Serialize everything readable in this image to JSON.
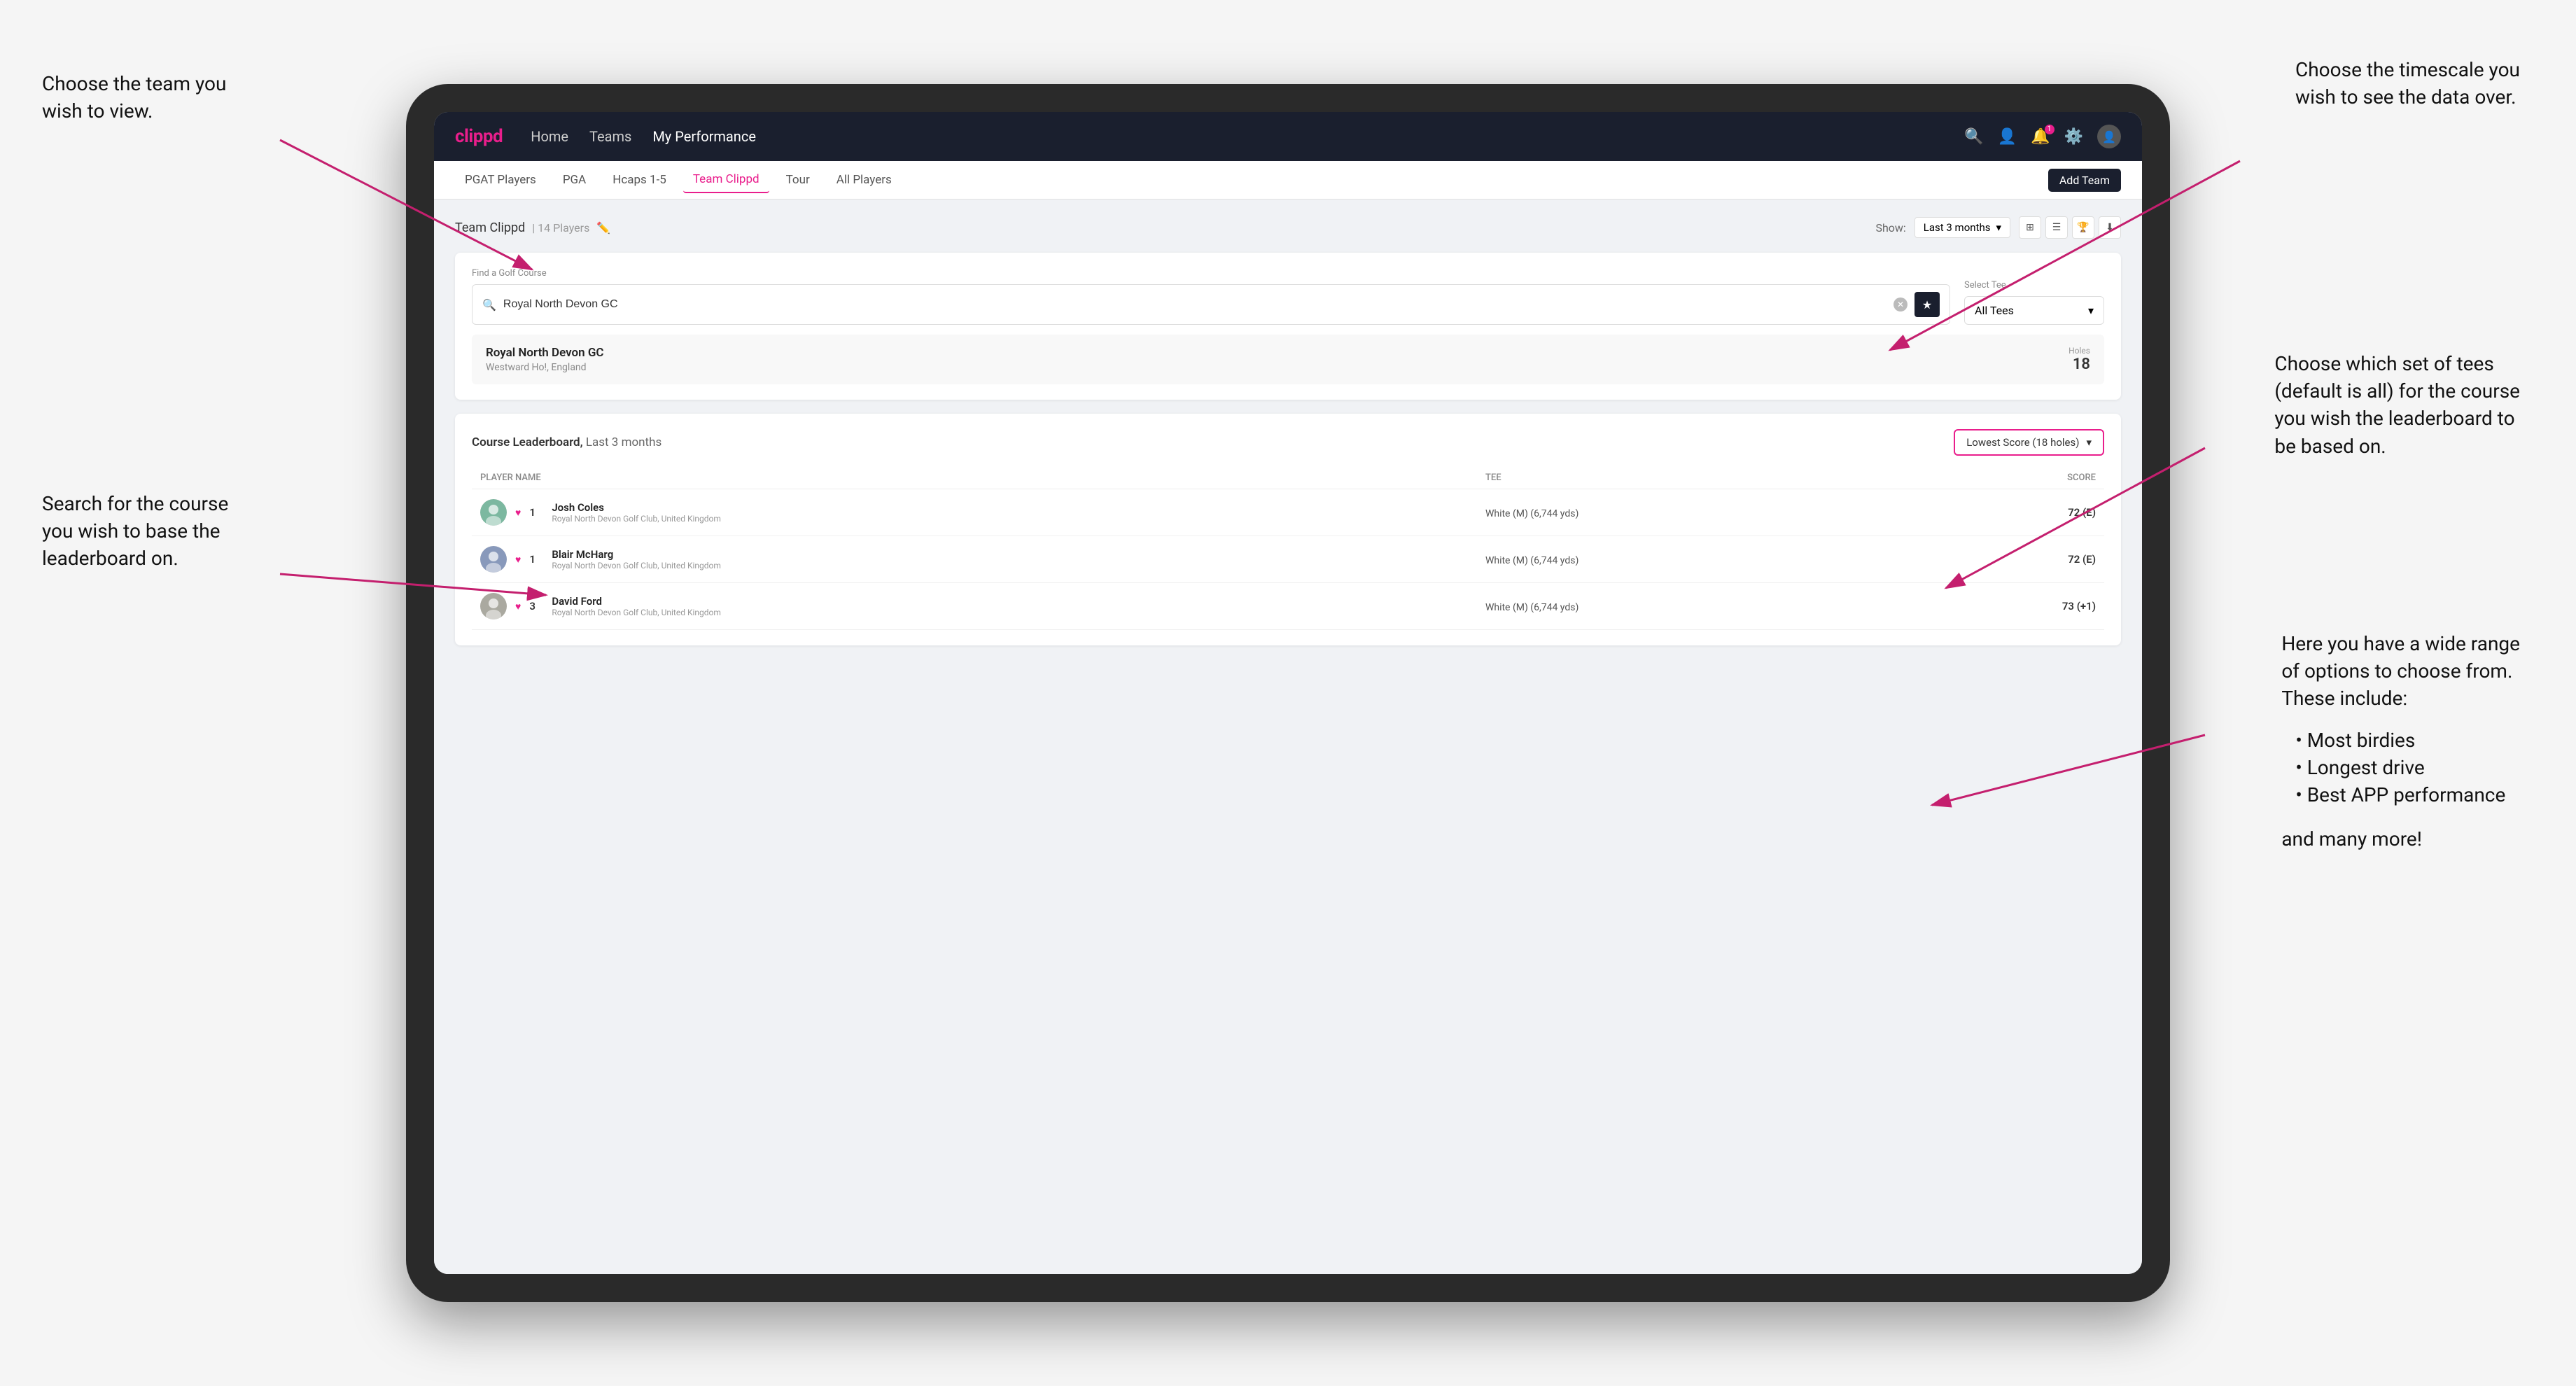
{
  "annotations": {
    "top_left_title": "Choose the team you\nwish to view.",
    "middle_left_title": "Search for the course\nyou wish to base the\nleaderboard on.",
    "top_right_title": "Choose the timescale you\nwish to see the data over.",
    "middle_right_title": "Choose which set of tees\n(default is all) for the course\nyou wish the leaderboard to\nbe based on.",
    "bottom_right_title": "Here you have a wide range\nof options to choose from.\nThese include:",
    "bullet1": "Most birdies",
    "bullet2": "Longest drive",
    "bullet3": "Best APP performance",
    "and_more": "and many more!"
  },
  "nav": {
    "logo": "clippd",
    "links": [
      "Home",
      "Teams",
      "My Performance"
    ],
    "active_link": "My Performance"
  },
  "sub_nav": {
    "links": [
      "PGAT Players",
      "PGA",
      "Hcaps 1-5",
      "Team Clippd",
      "Tour",
      "All Players"
    ],
    "active": "Team Clippd",
    "add_team_label": "Add Team"
  },
  "team_header": {
    "title": "Team Clippd",
    "player_count": "14 Players",
    "show_label": "Show:",
    "timescale": "Last 3 months"
  },
  "course_search": {
    "find_label": "Find a Golf Course",
    "search_value": "Royal North Devon GC",
    "select_tee_label": "Select Tee",
    "tee_value": "All Tees"
  },
  "course_result": {
    "name": "Royal North Devon GC",
    "location": "Westward Ho!, England",
    "holes_label": "Holes",
    "holes_value": "18"
  },
  "leaderboard": {
    "title": "Course Leaderboard,",
    "subtitle": "Last 3 months",
    "score_option": "Lowest Score (18 holes)",
    "col_player": "PLAYER NAME",
    "col_tee": "TEE",
    "col_score": "SCORE",
    "players": [
      {
        "rank": "1",
        "name": "Josh Coles",
        "club": "Royal North Devon Golf Club, United Kingdom",
        "tee": "White (M) (6,744 yds)",
        "score": "72 (E)"
      },
      {
        "rank": "1",
        "name": "Blair McHarg",
        "club": "Royal North Devon Golf Club, United Kingdom",
        "tee": "White (M) (6,744 yds)",
        "score": "72 (E)"
      },
      {
        "rank": "3",
        "name": "David Ford",
        "club": "Royal North Devon Golf Club, United Kingdom",
        "tee": "White (M) (6,744 yds)",
        "score": "73 (+1)"
      }
    ]
  }
}
